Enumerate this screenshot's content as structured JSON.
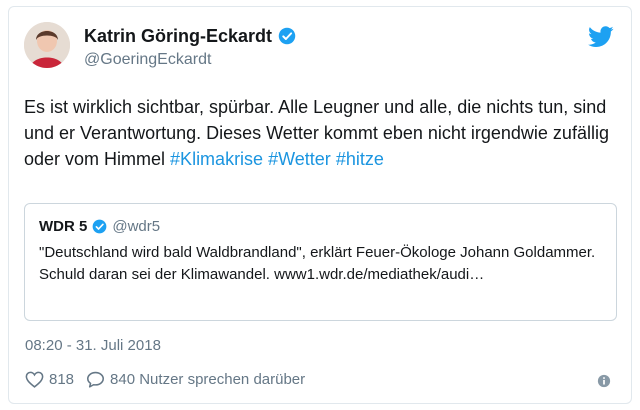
{
  "author": {
    "name": "Katrin Göring-Eckardt",
    "handle": "@GoeringEckardt",
    "verified_icon": "verified-badge-icon",
    "avatar_icon": "profile-avatar"
  },
  "tweet": {
    "text_main": "Es ist wirklich sichtbar, spürbar. Alle Leugner und alle, die nichts tun, sind und er Verantwortung. Dieses Wetter kommt eben nicht irgendwie zufällig oder vom Himmel",
    "hashtags": [
      "#Klimakrise",
      "#Wetter",
      "#hitze"
    ]
  },
  "quoted": {
    "name": "WDR 5",
    "handle": "@wdr5",
    "text": "\"Deutschland wird bald Waldbrandland\", erklärt Feuer-Ökologe Johann Goldammer. Schuld daran sei der Klimawandel. www1.wdr.de/mediathek/audi…"
  },
  "timestamp": "08:20 - 31. Juli 2018",
  "actions": {
    "likes": "818",
    "replies_label": "840 Nutzer sprechen darüber"
  },
  "colors": {
    "text": "#14171a",
    "secondary": "#657786",
    "accent": "#1b95e0",
    "border": "#e1e8ed",
    "twitter_blue": "#1da1f2"
  }
}
